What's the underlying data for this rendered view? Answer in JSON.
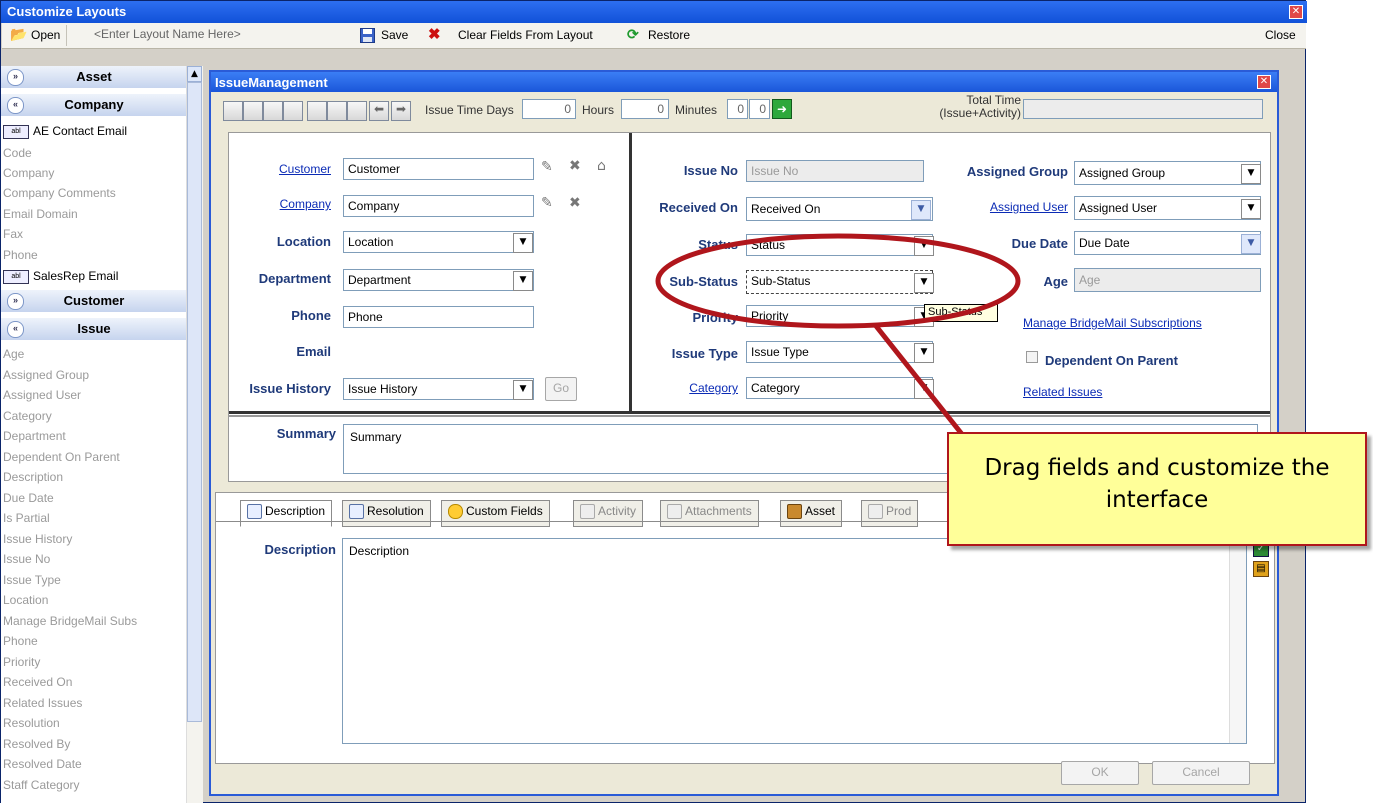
{
  "outer_window": {
    "title": "Customize Layouts",
    "close_label": "Close"
  },
  "toolbar": {
    "open_label": "Open",
    "layout_name_placeholder": "<Enter Layout Name Here>",
    "save_label": "Save",
    "clear_fields_label": "Clear Fields From Layout",
    "restore_label": "Restore"
  },
  "left_panel": {
    "groups": {
      "asset": "Asset",
      "company": "Company",
      "customer": "Customer",
      "issue": "Issue"
    },
    "company_fields": [
      "AE Contact Email",
      "Code",
      "Company",
      "Company Comments",
      "Email Domain",
      "Fax",
      "Phone",
      "SalesRep Email"
    ],
    "issue_fields": [
      "Age",
      "Assigned Group",
      "Assigned User",
      "Category",
      "Department",
      "Dependent On Parent",
      "Description",
      "Due Date",
      "Is Partial",
      "Issue History",
      "Issue No",
      "Issue Type",
      "Location",
      "Manage BridgeMail Subs",
      "Phone",
      "Priority",
      "Received On",
      "Related Issues",
      "Resolution",
      "Resolved By",
      "Resolved Date",
      "Staff Category"
    ]
  },
  "issue_window": {
    "title": "IssueManagement",
    "time": {
      "issue_time_label": "Issue Time  Days",
      "days": "0",
      "hours_label": "Hours",
      "hours": "0",
      "minutes_label": "Minutes",
      "minutes_a": "0",
      "minutes_b": "0",
      "total_time_label_1": "Total Time",
      "total_time_label_2": "(Issue+Activity)"
    },
    "left_col": {
      "customer_label": "Customer",
      "customer_value": "Customer",
      "company_label": "Company",
      "company_value": "Company",
      "location_label": "Location",
      "location_value": "Location",
      "department_label": "Department",
      "department_value": "Department",
      "phone_label": "Phone",
      "phone_value": "Phone",
      "email_label": "Email",
      "issue_history_label": "Issue History",
      "issue_history_value": "Issue History",
      "go_label": "Go"
    },
    "mid_col": {
      "issue_no_label": "Issue No",
      "issue_no_value": "Issue No",
      "received_on_label": "Received On",
      "received_on_value": "Received On",
      "status_label": "Status",
      "status_value": "Status",
      "sub_status_label": "Sub-Status",
      "sub_status_value": "Sub-Status",
      "priority_label": "Priority",
      "priority_value": "Priority",
      "issue_type_label": "Issue Type",
      "issue_type_value": "Issue Type",
      "category_label": "Category",
      "category_value": "Category",
      "tooltip": "Sub-Status"
    },
    "right_col": {
      "assigned_group_label": "Assigned Group",
      "assigned_group_value": "Assigned Group",
      "assigned_user_label": "Assigned User",
      "assigned_user_value": "Assigned User",
      "due_date_label": "Due Date",
      "due_date_value": "Due Date",
      "age_label": "Age",
      "age_value": "Age",
      "bridgemail_link": "Manage BridgeMail Subscriptions",
      "dependent_label": "Dependent On Parent",
      "related_issues_link": "Related Issues"
    },
    "summary": {
      "label": "Summary",
      "value": "Summary"
    },
    "tabs": [
      "Description",
      "Resolution",
      "Custom Fields",
      "Activity",
      "Attachments",
      "Asset",
      "Prod"
    ],
    "description": {
      "label": "Description",
      "value": "Description"
    },
    "buttons": {
      "ok": "OK",
      "cancel": "Cancel"
    }
  },
  "callout": {
    "text": "Drag fields and customize the interface",
    "color": "#ffff99",
    "ring_color": "#b0161c"
  }
}
